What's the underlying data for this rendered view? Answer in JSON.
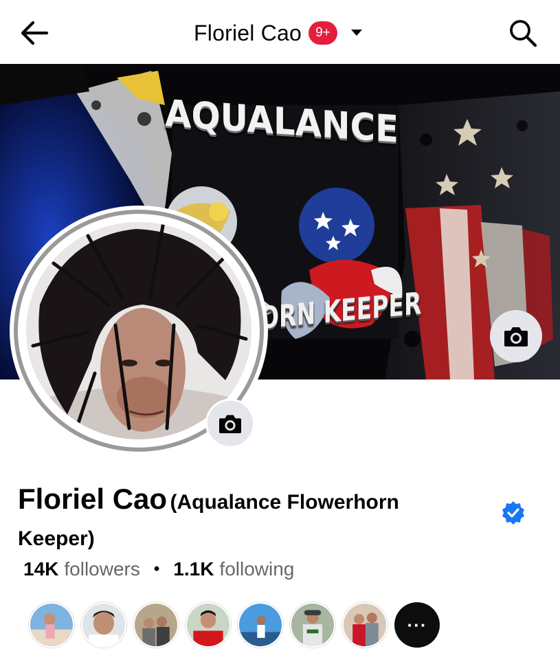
{
  "header": {
    "title": "Floriel Cao",
    "notification_badge": "9+",
    "back_icon": "arrow-left-icon",
    "dropdown_icon": "caret-down-icon",
    "search_icon": "search-icon"
  },
  "cover": {
    "title_top": "AQUALANCE",
    "title_bottom": "ORN KEEPER",
    "camera_icon": "camera-icon"
  },
  "profile": {
    "display_name": "Floriel Cao",
    "alternate_name": "(Aqualance Flowerhorn Keeper)",
    "verified": true,
    "camera_icon": "camera-icon"
  },
  "stats": {
    "followers_count": "14K",
    "followers_label": "followers",
    "separator": "•",
    "following_count": "1.1K",
    "following_label": "following"
  },
  "followers_preview": {
    "more_label": "···"
  },
  "colors": {
    "accent_blue": "#1877f2",
    "badge_red": "#e41e3f",
    "secondary_text": "#65676b",
    "button_bg": "#e4e6eb"
  }
}
